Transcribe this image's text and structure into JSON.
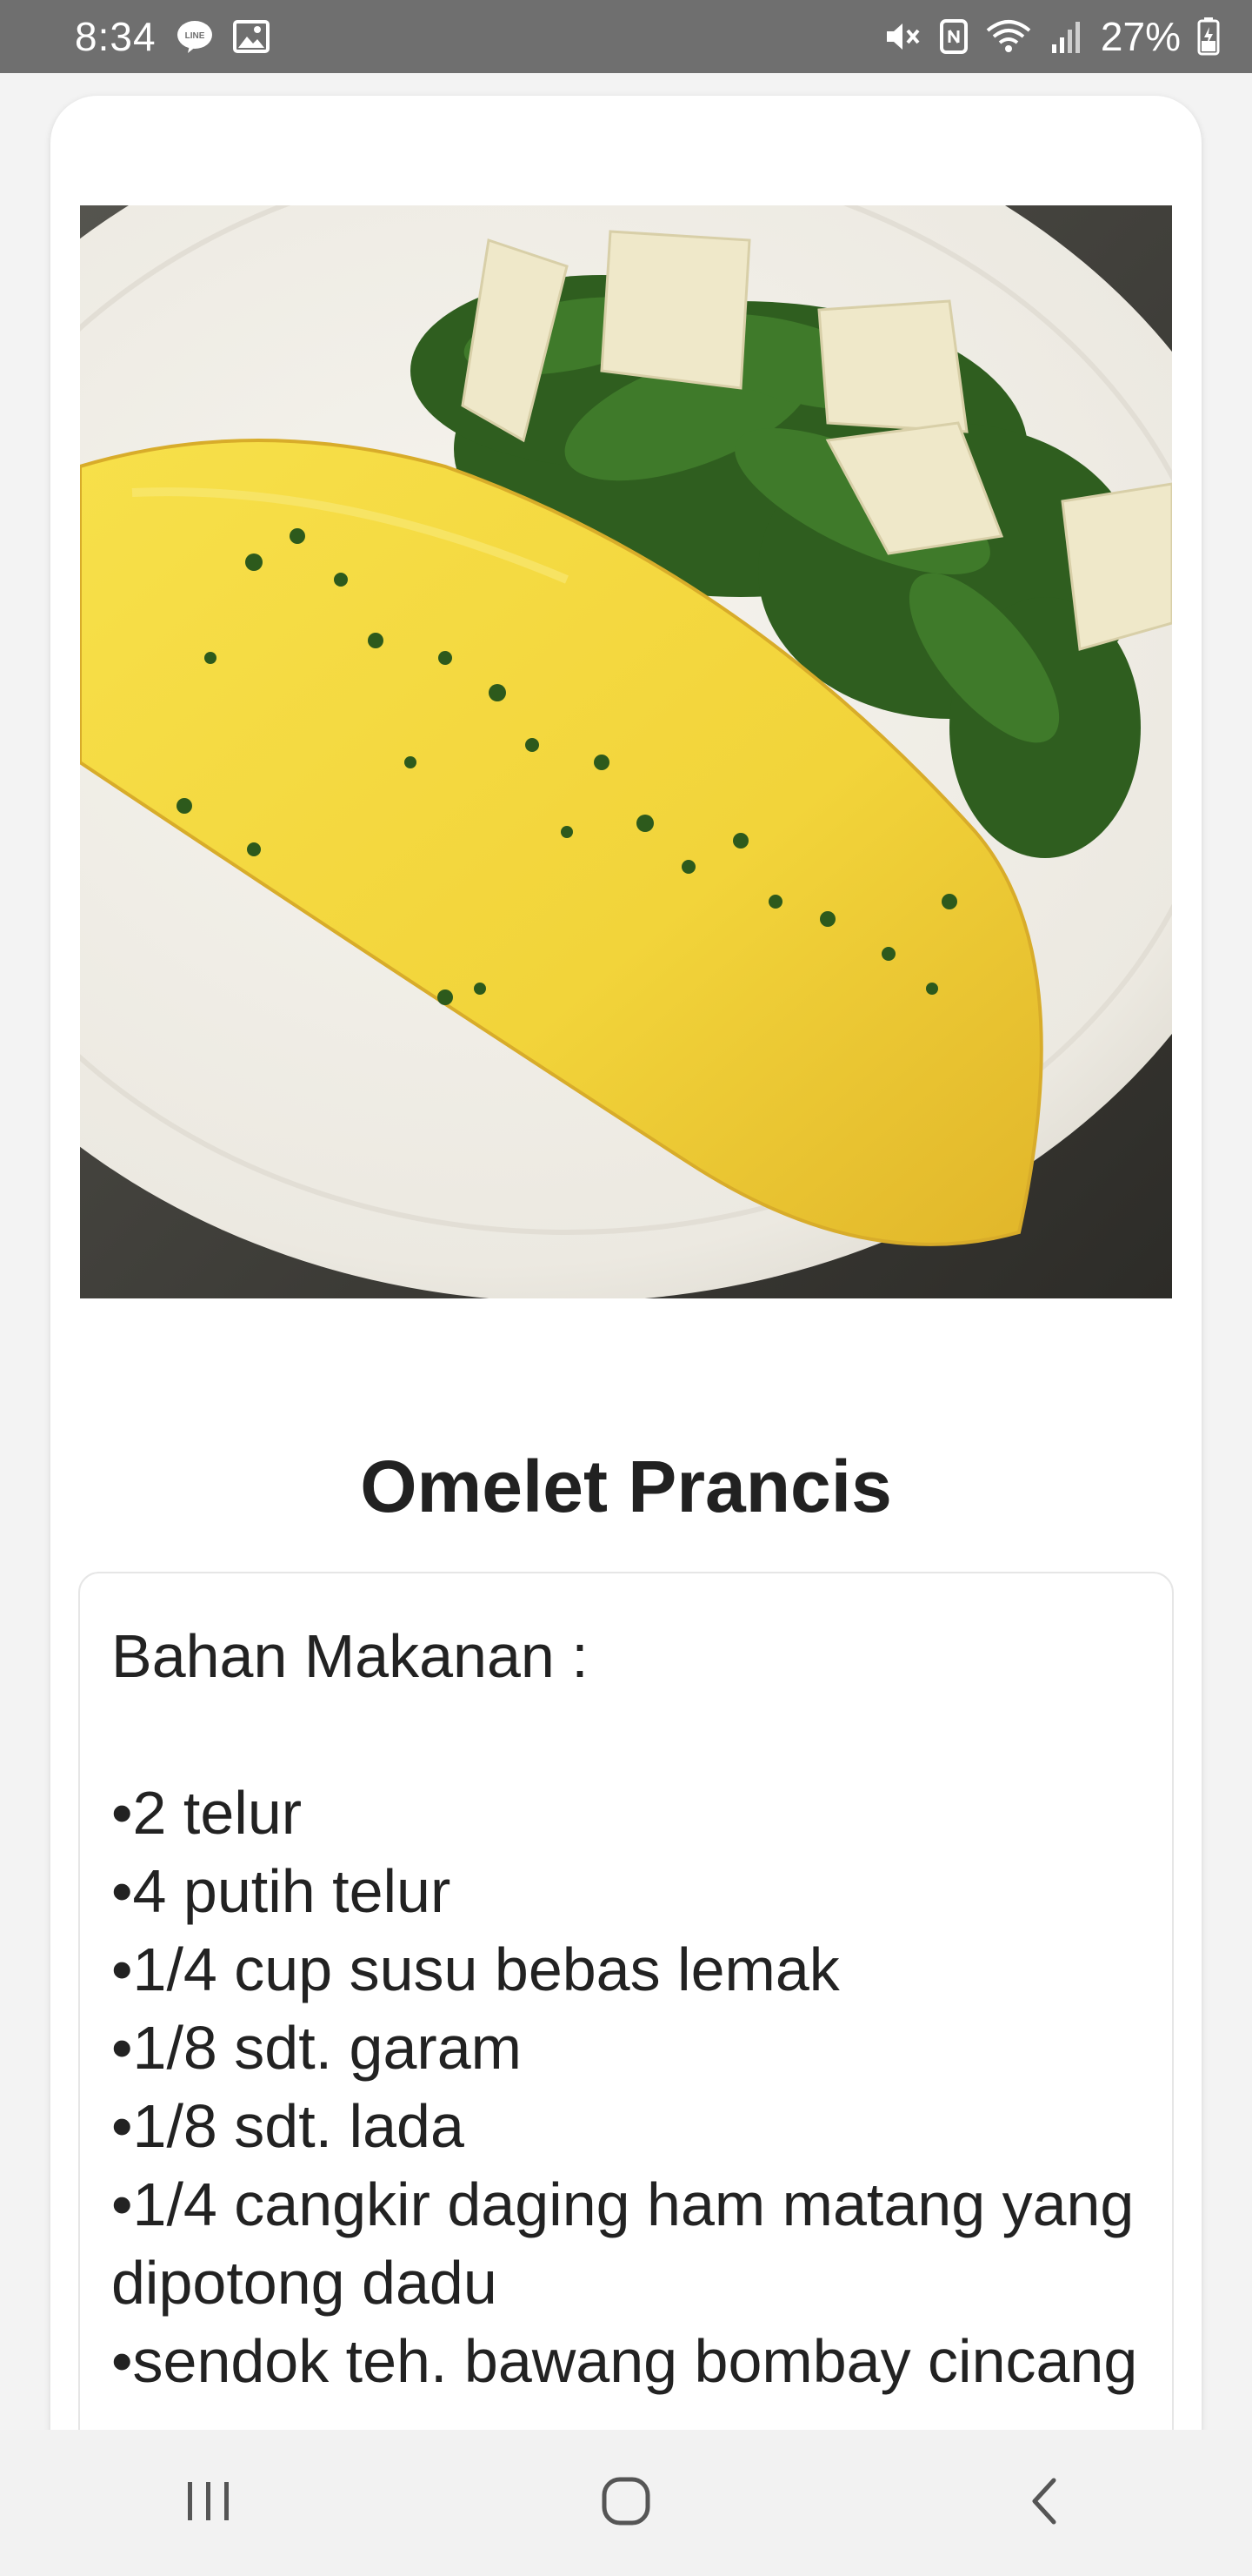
{
  "status_bar": {
    "time": "8:34",
    "battery": "27%",
    "left_icons": [
      "line-icon",
      "image-icon"
    ],
    "right_icons": [
      "mute-icon",
      "nfc-icon",
      "wifi-icon",
      "signal-icon",
      "battery-icon"
    ]
  },
  "recipe": {
    "title": "Omelet Prancis",
    "ingredients_heading": "Bahan Makanan :",
    "ingredients": [
      "•2 telur",
      "•4 putih telur",
      "•1/4 cup susu bebas lemak",
      "•1/8 sdt. garam",
      "•1/8 sdt. lada",
      "•1/4 cangkir daging ham matang yang dipotong dadu",
      "•sendok teh. bawang bombay cincang"
    ]
  },
  "nav_bar": {
    "icons": [
      "recent-apps-icon",
      "home-icon",
      "back-icon"
    ]
  },
  "colors": {
    "status_bar_bg": "#6f6f6f",
    "omelet_yellow": "#f2d43a",
    "plate": "#f1efe9",
    "greens": "#2f5e1f"
  }
}
